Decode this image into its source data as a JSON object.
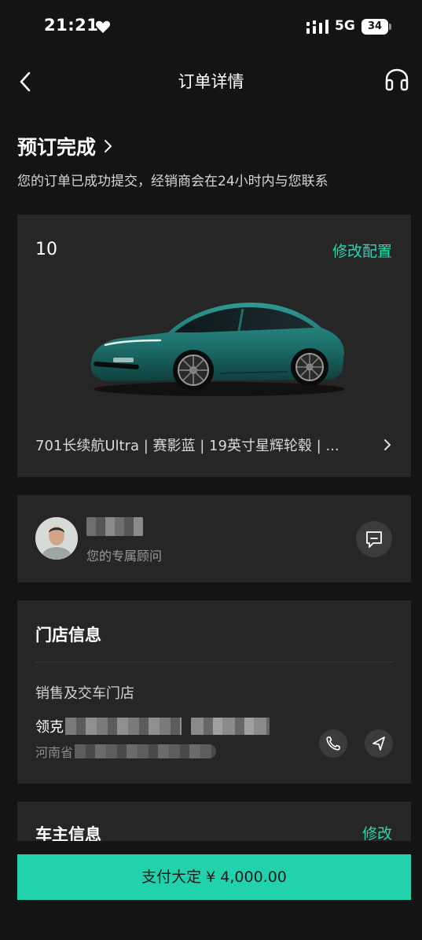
{
  "status_bar": {
    "time": "21:21",
    "network": "5G",
    "battery": "34"
  },
  "nav": {
    "title": "订单详情",
    "icons": {
      "back": "chevron-left-icon",
      "support": "headset-icon"
    }
  },
  "order": {
    "status": "预订完成",
    "description": "您的订单已成功提交，经销商会在24小时内与您联系"
  },
  "car": {
    "model": "10",
    "edit_label": "修改配置",
    "spec": "701长续航Ultra | 赛影蓝 | 19英寸星辉轮毂 | ..."
  },
  "advisor": {
    "role": "您的专属顾问"
  },
  "store": {
    "title": "门店信息",
    "label": "销售及交车门店",
    "name_prefix": "领克",
    "address_prefix": "河南省"
  },
  "owner": {
    "title": "车主信息",
    "edit_label": "修改"
  },
  "payment": {
    "button_label": "支付大定 ¥ 4,000.00"
  },
  "colors": {
    "background": "#141414",
    "card": "#262626",
    "accent": "#2ad6b0",
    "pay_button": "#22d2ac"
  }
}
